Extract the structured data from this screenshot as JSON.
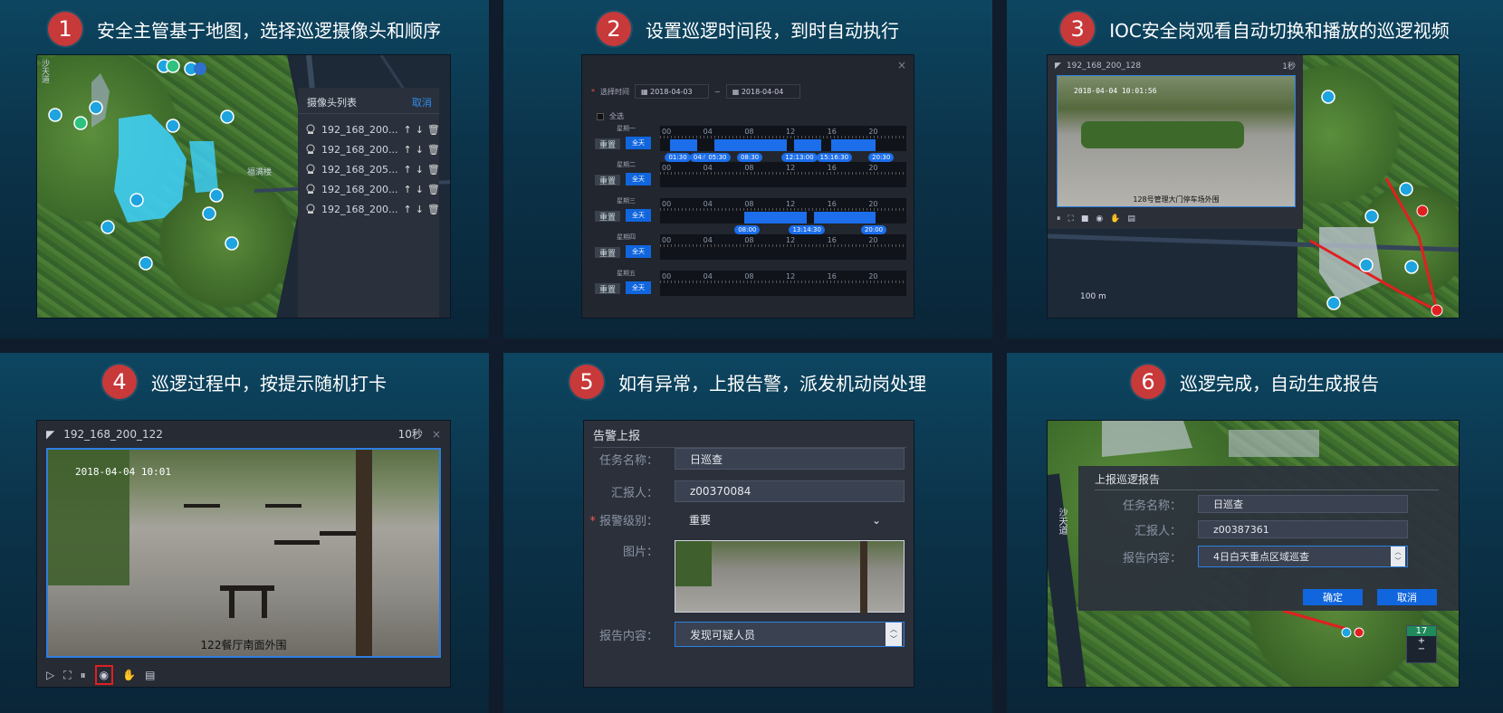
{
  "cards": [
    {
      "num": "1",
      "title": "安全主管基于地图，选择巡逻摄像头和顺序"
    },
    {
      "num": "2",
      "title": "设置巡逻时间段，到时自动执行"
    },
    {
      "num": "3",
      "title": "IOC安全岗观看自动切换和播放的巡逻视频"
    },
    {
      "num": "4",
      "title": "巡逻过程中，按提示随机打卡"
    },
    {
      "num": "5",
      "title": "如有异常，上报告警，派发机动岗处理"
    },
    {
      "num": "6",
      "title": "巡逻完成，自动生成报告"
    }
  ],
  "camera_list": {
    "title": "摄像头列表",
    "action": "取消",
    "items": [
      "192_168_200...",
      "192_168_200...",
      "192_168_205...",
      "192_168_200...",
      "192_168_200..."
    ]
  },
  "map1": {
    "label_fu": "福满楼",
    "label_road": "沙天道"
  },
  "schedule": {
    "time_label": "选择时间",
    "date_from": "2018-04-03",
    "date_to": "2018-04-04",
    "select_all": "全选",
    "reset": "重置",
    "all_day": "全天",
    "days": [
      "星期一",
      "星期二",
      "星期三",
      "星期四",
      "星期五"
    ],
    "ticks": [
      "00",
      "04",
      "08",
      "12",
      "16",
      "20"
    ],
    "mon_labels": [
      "01:30",
      "04:00",
      "05:30",
      "08:30",
      "12:13:00",
      "15:16:30",
      "20:30"
    ],
    "wed_labels": [
      "08:00",
      "13:14:30",
      "20:00"
    ]
  },
  "viewer3": {
    "camera": "192_168_200_128",
    "interval": "1秒",
    "timestamp": "2018-04-04 10:01:56",
    "caption": "128号管理大门停车场外围",
    "scale": "100 m"
  },
  "viewer4": {
    "camera": "192_168_200_122",
    "interval": "10秒",
    "timestamp": "2018-04-04 10:01",
    "caption": "122餐厅南面外围"
  },
  "alarm": {
    "title": "告警上报",
    "task_label": "任务名称：",
    "task_value": "日巡查",
    "reporter_label": "汇报人：",
    "reporter_value": "z00370084",
    "level_label": "报警级别：",
    "level_value": "重要",
    "image_label": "图片：",
    "content_label": "报告内容：",
    "content_value": "发现可疑人员"
  },
  "report": {
    "title": "上报巡逻报告",
    "task_label": "任务名称：",
    "task_value": "日巡查",
    "reporter_label": "汇报人：",
    "reporter_value": "z00387361",
    "content_label": "报告内容：",
    "content_value": "4日白天重点区域巡查",
    "ok": "确定",
    "cancel": "取消",
    "zoom": "17",
    "road": "沙天道"
  },
  "colors": {
    "accent_red": "#c8393a",
    "primary_blue": "#1166dd",
    "card_bg": "#0b3349"
  }
}
